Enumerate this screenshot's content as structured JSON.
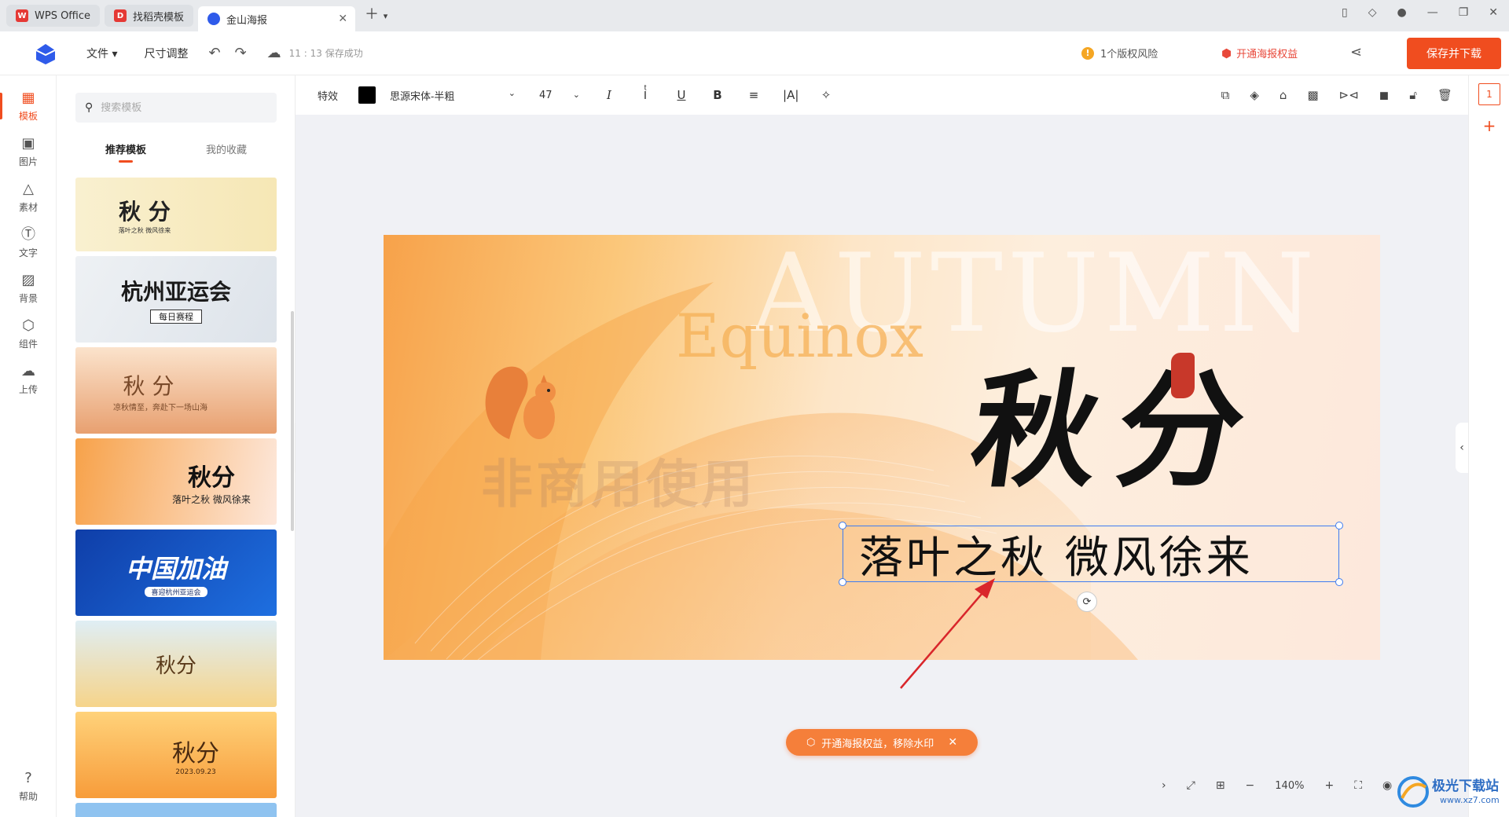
{
  "browser": {
    "tabs": [
      {
        "label": "WPS Office",
        "icon": "wps-icon"
      },
      {
        "label": "找稻壳模板",
        "icon": "docer-icon"
      },
      {
        "label": "金山海报",
        "icon": "poster-icon",
        "active": true
      }
    ]
  },
  "header": {
    "file_menu": "文件",
    "size_menu": "尺寸调整",
    "save_status": "11 : 13 保存成功",
    "copyright_risk": "1个版权风险",
    "open_rights": "开通海报权益",
    "save_download": "保存并下载"
  },
  "rail": {
    "items": [
      {
        "label": "模板",
        "icon": "template-icon",
        "active": true
      },
      {
        "label": "图片",
        "icon": "image-icon"
      },
      {
        "label": "素材",
        "icon": "material-icon"
      },
      {
        "label": "文字",
        "icon": "text-icon"
      },
      {
        "label": "背景",
        "icon": "background-icon"
      },
      {
        "label": "组件",
        "icon": "component-icon"
      },
      {
        "label": "上传",
        "icon": "upload-icon"
      }
    ],
    "help": "帮助"
  },
  "panel": {
    "search_placeholder": "搜索模板",
    "tabs": [
      "推荐模板",
      "我的收藏"
    ],
    "thumbs": [
      {
        "title": "秋 分",
        "sub": "落叶之秋 微风徐来"
      },
      {
        "title": "杭州亚运会",
        "sub": "每日赛程"
      },
      {
        "title": "秋 分",
        "sub": "凉秋情至，奔赴下一场山海"
      },
      {
        "title": "秋分",
        "sub": "落叶之秋 微风徐来"
      },
      {
        "title": "中国加油",
        "sub": "喜迎杭州亚运会"
      },
      {
        "title": "秋分",
        "sub": ""
      },
      {
        "title": "秋分",
        "sub": "2023.09.23"
      }
    ]
  },
  "toolbar": {
    "effect": "特效",
    "font": "思源宋体-半粗",
    "size": "47",
    "italic": "I",
    "bold": "B",
    "underline": "U"
  },
  "poster": {
    "autumn": "AUTUMN",
    "equinox": "Equinox",
    "watermark": "非商用使用",
    "calligraphy": "秋分",
    "selected_text": "落叶之秋 微风徐来"
  },
  "promo": {
    "text": "开通海报权益，移除水印"
  },
  "zoom": {
    "level": "140%"
  },
  "pages": {
    "current": "1"
  },
  "site": {
    "name": "极光下载站",
    "url": "www.xz7.com"
  }
}
